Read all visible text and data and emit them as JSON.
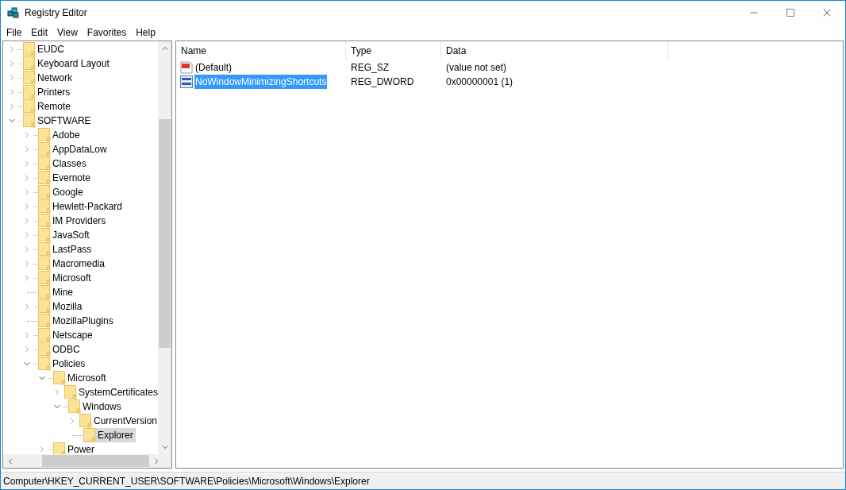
{
  "window": {
    "title": "Registry Editor"
  },
  "menu": [
    "File",
    "Edit",
    "View",
    "Favorites",
    "Help"
  ],
  "tree": [
    {
      "name": "EUDC",
      "expandable": true,
      "expanded": false,
      "selected": false
    },
    {
      "name": "Keyboard Layout",
      "expandable": true,
      "expanded": false,
      "selected": false
    },
    {
      "name": "Network",
      "expandable": true,
      "expanded": false,
      "selected": false
    },
    {
      "name": "Printers",
      "expandable": true,
      "expanded": false,
      "selected": false
    },
    {
      "name": "Remote",
      "expandable": true,
      "expanded": false,
      "selected": false
    },
    {
      "name": "SOFTWARE",
      "expandable": true,
      "expanded": true,
      "selected": false,
      "children": [
        {
          "name": "Adobe",
          "expandable": true,
          "expanded": false,
          "selected": false
        },
        {
          "name": "AppDataLow",
          "expandable": true,
          "expanded": false,
          "selected": false
        },
        {
          "name": "Classes",
          "expandable": true,
          "expanded": false,
          "selected": false
        },
        {
          "name": "Evernote",
          "expandable": true,
          "expanded": false,
          "selected": false
        },
        {
          "name": "Google",
          "expandable": true,
          "expanded": false,
          "selected": false
        },
        {
          "name": "Hewlett-Packard",
          "expandable": true,
          "expanded": false,
          "selected": false
        },
        {
          "name": "IM Providers",
          "expandable": true,
          "expanded": false,
          "selected": false
        },
        {
          "name": "JavaSoft",
          "expandable": true,
          "expanded": false,
          "selected": false
        },
        {
          "name": "LastPass",
          "expandable": true,
          "expanded": false,
          "selected": false
        },
        {
          "name": "Macromedia",
          "expandable": true,
          "expanded": false,
          "selected": false
        },
        {
          "name": "Microsoft",
          "expandable": true,
          "expanded": false,
          "selected": false
        },
        {
          "name": "Mine",
          "expandable": false,
          "selected": false
        },
        {
          "name": "Mozilla",
          "expandable": true,
          "expanded": false,
          "selected": false
        },
        {
          "name": "MozillaPlugins",
          "expandable": false,
          "selected": false
        },
        {
          "name": "Netscape",
          "expandable": true,
          "expanded": false,
          "selected": false
        },
        {
          "name": "ODBC",
          "expandable": true,
          "expanded": false,
          "selected": false
        },
        {
          "name": "Policies",
          "expandable": true,
          "expanded": true,
          "selected": false,
          "children": [
            {
              "name": "Microsoft",
              "expandable": true,
              "expanded": true,
              "selected": false,
              "children": [
                {
                  "name": "SystemCertificates",
                  "expandable": true,
                  "expanded": false,
                  "selected": false
                },
                {
                  "name": "Windows",
                  "expandable": true,
                  "expanded": true,
                  "selected": false,
                  "children": [
                    {
                      "name": "CurrentVersion",
                      "expandable": true,
                      "expanded": false,
                      "selected": false
                    },
                    {
                      "name": "Explorer",
                      "expandable": false,
                      "selected": true
                    }
                  ]
                }
              ]
            },
            {
              "name": "Power",
              "expandable": true,
              "expanded": false,
              "selected": false
            }
          ]
        }
      ]
    }
  ],
  "table": {
    "columns": [
      "Name",
      "Type",
      "Data"
    ],
    "rows": [
      {
        "kind": "string",
        "name": "(Default)",
        "type": "REG_SZ",
        "data": "(value not set)",
        "selected": false
      },
      {
        "kind": "dword",
        "name": "NoWindowMinimizingShortcuts",
        "type": "REG_DWORD",
        "data": "0x00000001 (1)",
        "selected": true
      }
    ]
  },
  "status_bar": "Computer\\HKEY_CURRENT_USER\\SOFTWARE\\Policies\\Microsoft\\Windows\\Explorer"
}
